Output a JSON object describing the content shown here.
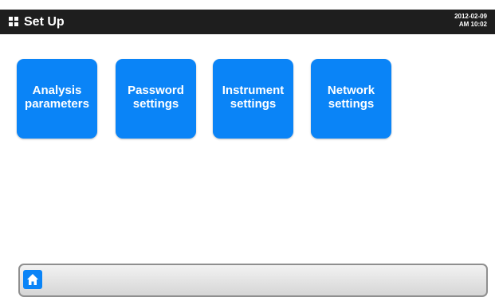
{
  "header": {
    "title": "Set Up",
    "date": "2012-02-09",
    "time": "AM 10:02",
    "menu_icon": "grid-icon"
  },
  "tiles": [
    {
      "line1": "Analysis",
      "line2": "parameters"
    },
    {
      "line1": "Password",
      "line2": "settings"
    },
    {
      "line1": "Instrument",
      "line2": "settings"
    },
    {
      "line1": "Network",
      "line2": "settings"
    }
  ],
  "footer": {
    "home_icon": "home-icon"
  },
  "colors": {
    "accent": "#0a84f7",
    "header_bg": "#1e1e1e"
  }
}
